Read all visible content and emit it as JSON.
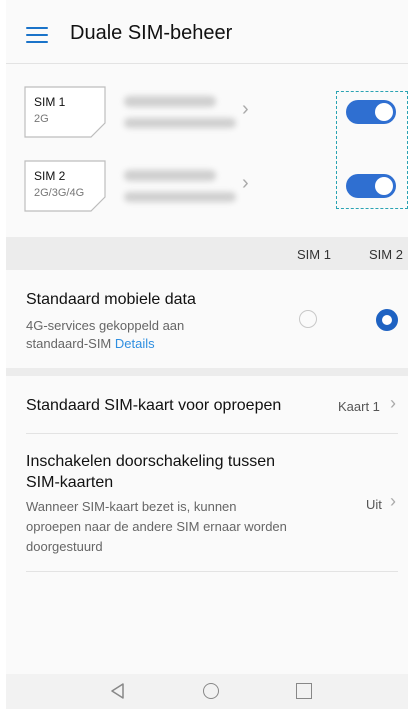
{
  "header": {
    "title": "Duale SIM-beheer",
    "menu_icon": "menu-icon"
  },
  "sims": [
    {
      "name": "SIM 1",
      "network": "2G",
      "enabled": true
    },
    {
      "name": "SIM 2",
      "network": "2G/3G/4G",
      "enabled": true
    }
  ],
  "columns": {
    "sim1": "SIM 1",
    "sim2": "SIM 2"
  },
  "mobile_data": {
    "title": "Standaard mobiele data",
    "subtitle_line1": "4G-services gekoppeld aan",
    "subtitle_line2": "standaard-SIM ",
    "link": "Details",
    "selected": "SIM 2"
  },
  "call_default": {
    "title": "Standaard SIM-kaart voor oproepen",
    "value": "Kaart 1"
  },
  "forwarding": {
    "title_line1": "Inschakelen doorschakeling tussen",
    "title_line2": "SIM-kaarten",
    "desc_line1": "Wanneer SIM-kaart bezet is, kunnen",
    "desc_line2": "oproepen naar de andere SIM ernaar worden",
    "desc_line3": "doorgestuurd",
    "value": "Uit"
  },
  "colors": {
    "accent": "#2f6fd1",
    "link": "#2f8fe0",
    "highlight_box": "#2aa3b3"
  }
}
